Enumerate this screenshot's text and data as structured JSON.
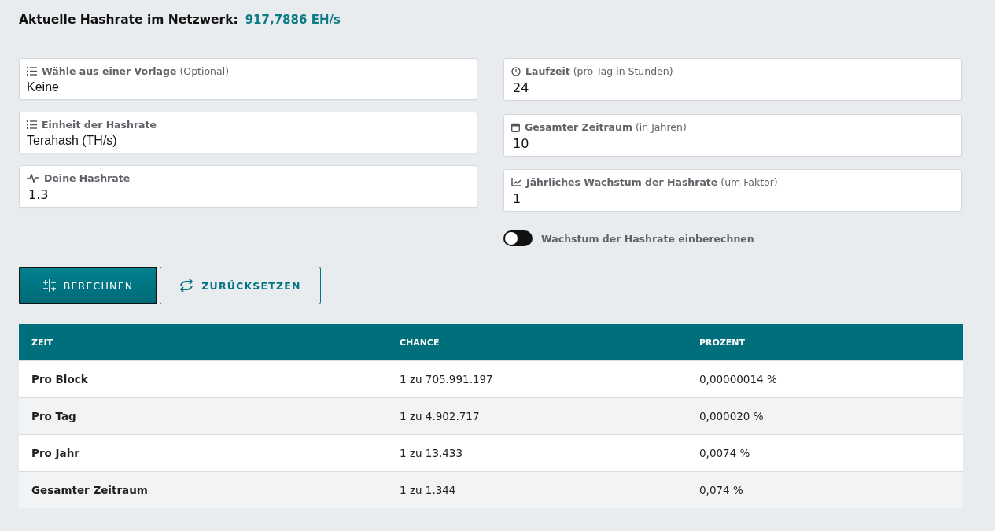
{
  "network_hashrate": {
    "label": "Aktuelle Hashrate im Netzwerk:",
    "value": "917,7886 EH/s"
  },
  "left_fields": [
    {
      "kind": "select",
      "label": "**Wähle aus einer Vorlage** (Optional)",
      "value": "Keine"
    },
    {
      "kind": "select",
      "label": "**Einheit der Hashrate**",
      "value": "Terahash (TH/s)"
    },
    {
      "kind": "input",
      "label": "**Deine Hashrate**",
      "value": "1.3"
    }
  ],
  "right_fields": [
    {
      "kind": "input",
      "label": "**Laufzeit** (pro Tag in Stunden)",
      "value": "24"
    },
    {
      "kind": "input",
      "label": "**Gesamter Zeitraum** (in Jahren)",
      "value": "10"
    },
    {
      "kind": "input",
      "label": "**Jährliches Wachstum der Hashrate** (um Faktor)",
      "value": "1"
    }
  ],
  "toggle": {
    "label": "Wachstum der Hashrate einberechnen",
    "on": false
  },
  "buttons": [
    {
      "kind": "primary",
      "label": "BERECHNEN"
    },
    {
      "kind": "outline",
      "label": "ZURÜCKSETZEN"
    }
  ],
  "table": {
    "columns": [
      "ZEIT",
      "CHANCE",
      "PROZENT"
    ],
    "rows": [
      [
        "Pro Block",
        "1 zu 705.991.197",
        "0,00000014 %"
      ],
      [
        "Pro Tag",
        "1 zu 4.902.717",
        "0,000020 %"
      ],
      [
        "Pro Jahr",
        "1 zu 13.433",
        "0,0074 %"
      ],
      [
        "Gesamter Zeitraum",
        "1 zu 1.344",
        "0,074 %"
      ]
    ]
  }
}
